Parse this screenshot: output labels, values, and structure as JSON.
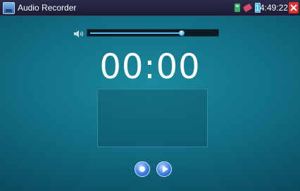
{
  "window": {
    "title": "Audio Recorder"
  },
  "statusbar": {
    "time": "14:49:22",
    "icons": [
      "sd-card-icon",
      "usb-icon",
      "battery-icon"
    ]
  },
  "volume": {
    "level": 0.73
  },
  "recorder": {
    "elapsed": "00:00"
  },
  "controls": [
    "record-icon",
    "play-icon"
  ],
  "colors": {
    "titlebar": "#1f2140",
    "close": "#e0342b",
    "accent": "#3d7ee6",
    "background": "#116f85"
  }
}
